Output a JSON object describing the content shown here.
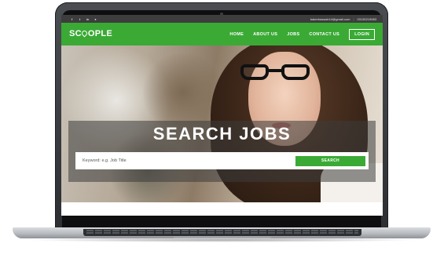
{
  "topbar": {
    "social": [
      {
        "icon": "facebook-icon",
        "glyph": "f"
      },
      {
        "icon": "twitter-icon",
        "glyph": "t"
      },
      {
        "icon": "linkedin-icon",
        "glyph": "in"
      },
      {
        "icon": "user-icon",
        "glyph": "●"
      }
    ],
    "email": "bakerhassain14@gmail.com",
    "phone": "03130219083"
  },
  "navbar": {
    "logo_text_pre": "SC",
    "logo_text_post": "OPLE",
    "logo_tagline": "",
    "links": [
      "HOME",
      "ABOUT US",
      "JOBS",
      "CONTACT US"
    ],
    "login_label": "LOGIN"
  },
  "hero": {
    "title": "SEARCH JOBS",
    "search_placeholder": "Keyword: e.g. Job Title",
    "search_button": "SEARCH"
  },
  "colors": {
    "brand_green": "#3aaa35",
    "topbar_bg": "#3d3d3d"
  }
}
